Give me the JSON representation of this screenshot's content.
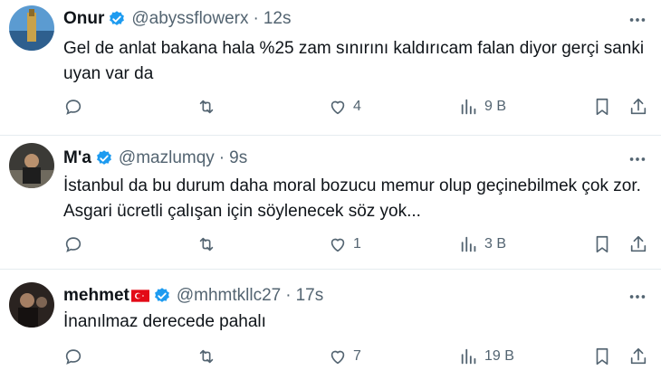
{
  "tweets": [
    {
      "display_name": "Onur",
      "handle": "@abyssflowerx",
      "time": "12s",
      "text": "Gel de anlat bakana hala %25 zam sınırını kaldırıcam falan diyor gerçi sanki uyan var da",
      "reply_count": "",
      "retweet_count": "",
      "like_count": "4",
      "view_count": "9 B"
    },
    {
      "display_name": "M'a",
      "handle": "@mazlumqy",
      "time": "9s",
      "text": "İstanbul da bu durum daha moral bozucu memur olup geçinebilmek çok zor. Asgari ücretli çalışan için söylenecek söz yok...",
      "reply_count": "",
      "retweet_count": "",
      "like_count": "1",
      "view_count": "3 B"
    },
    {
      "display_name": "mehmet",
      "handle": "@mhmtkllc27",
      "time": "17s",
      "text": "İnanılmaz derecede pahalı",
      "reply_count": "",
      "retweet_count": "",
      "like_count": "7",
      "view_count": "19 B"
    }
  ],
  "colors": {
    "verified": "#1d9bf0",
    "muted": "#536471",
    "divider": "#e6ecf0",
    "flag_red": "#e30a17"
  },
  "icons": [
    "verified-badge-icon",
    "more-icon",
    "reply-icon",
    "retweet-icon",
    "like-icon",
    "views-icon",
    "bookmark-icon",
    "share-icon",
    "turkey-flag-icon"
  ]
}
